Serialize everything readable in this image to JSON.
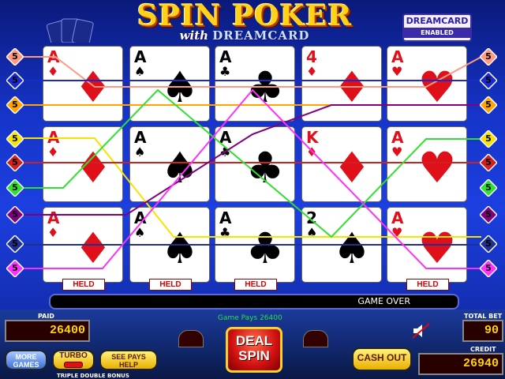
{
  "title": {
    "line1": "SPIN POKER",
    "line2_with": "with",
    "line2_brand": "DREAMCARD"
  },
  "badge": {
    "top": "DREAMCARD",
    "bottom": "ENABLED"
  },
  "columns": [
    {
      "cards": [
        {
          "rank": "A",
          "suit": "♦",
          "color": "red"
        },
        {
          "rank": "A",
          "suit": "♦",
          "color": "red"
        },
        {
          "rank": "A",
          "suit": "♦",
          "color": "red"
        }
      ],
      "held": "HELD"
    },
    {
      "cards": [
        {
          "rank": "A",
          "suit": "♠",
          "color": "blk"
        },
        {
          "rank": "A",
          "suit": "♠",
          "color": "blk"
        },
        {
          "rank": "A",
          "suit": "♠",
          "color": "blk"
        }
      ],
      "held": "HELD"
    },
    {
      "cards": [
        {
          "rank": "A",
          "suit": "♣",
          "color": "blk"
        },
        {
          "rank": "A",
          "suit": "♣",
          "color": "blk"
        },
        {
          "rank": "A",
          "suit": "♣",
          "color": "blk"
        }
      ],
      "held": "HELD"
    },
    {
      "cards": [
        {
          "rank": "4",
          "suit": "♦",
          "color": "red"
        },
        {
          "rank": "K",
          "suit": "♦",
          "color": "red"
        },
        {
          "rank": "2",
          "suit": "♠",
          "color": "blk"
        }
      ],
      "held": ""
    },
    {
      "cards": [
        {
          "rank": "A",
          "suit": "♥",
          "color": "red"
        },
        {
          "rank": "A",
          "suit": "♥",
          "color": "red"
        },
        {
          "rank": "A",
          "suit": "♥",
          "color": "red"
        }
      ],
      "held": "HELD"
    }
  ],
  "bets_left": [
    "5",
    "5",
    "5",
    "5",
    "5",
    "5",
    "5",
    "5",
    "5"
  ],
  "bets_right": [
    "5",
    "5",
    "5",
    "5",
    "5",
    "5",
    "5",
    "5",
    "5"
  ],
  "status": "GAME OVER",
  "game_pays": "Game Pays 26400",
  "paid": {
    "label": "PAID",
    "value": "26400"
  },
  "total_bet": {
    "label": "TOTAL BET",
    "value": "90"
  },
  "credit": {
    "label": "CREDIT",
    "value": "26940"
  },
  "buttons": {
    "more_games": "MORE GAMES",
    "turbo": "TURBO",
    "see_pays": "SEE PAYS HELP",
    "deal": "DEAL SPIN",
    "cash_out": "CASH OUT"
  },
  "game_name": "TRIPLE DOUBLE BONUS",
  "colors": {
    "line_colors": [
      "#ff9a80",
      "#1a2acc",
      "#ffa500",
      "#f5e400",
      "#d02020",
      "#30e030",
      "#800080",
      "#203090",
      "#ff30ff"
    ]
  }
}
